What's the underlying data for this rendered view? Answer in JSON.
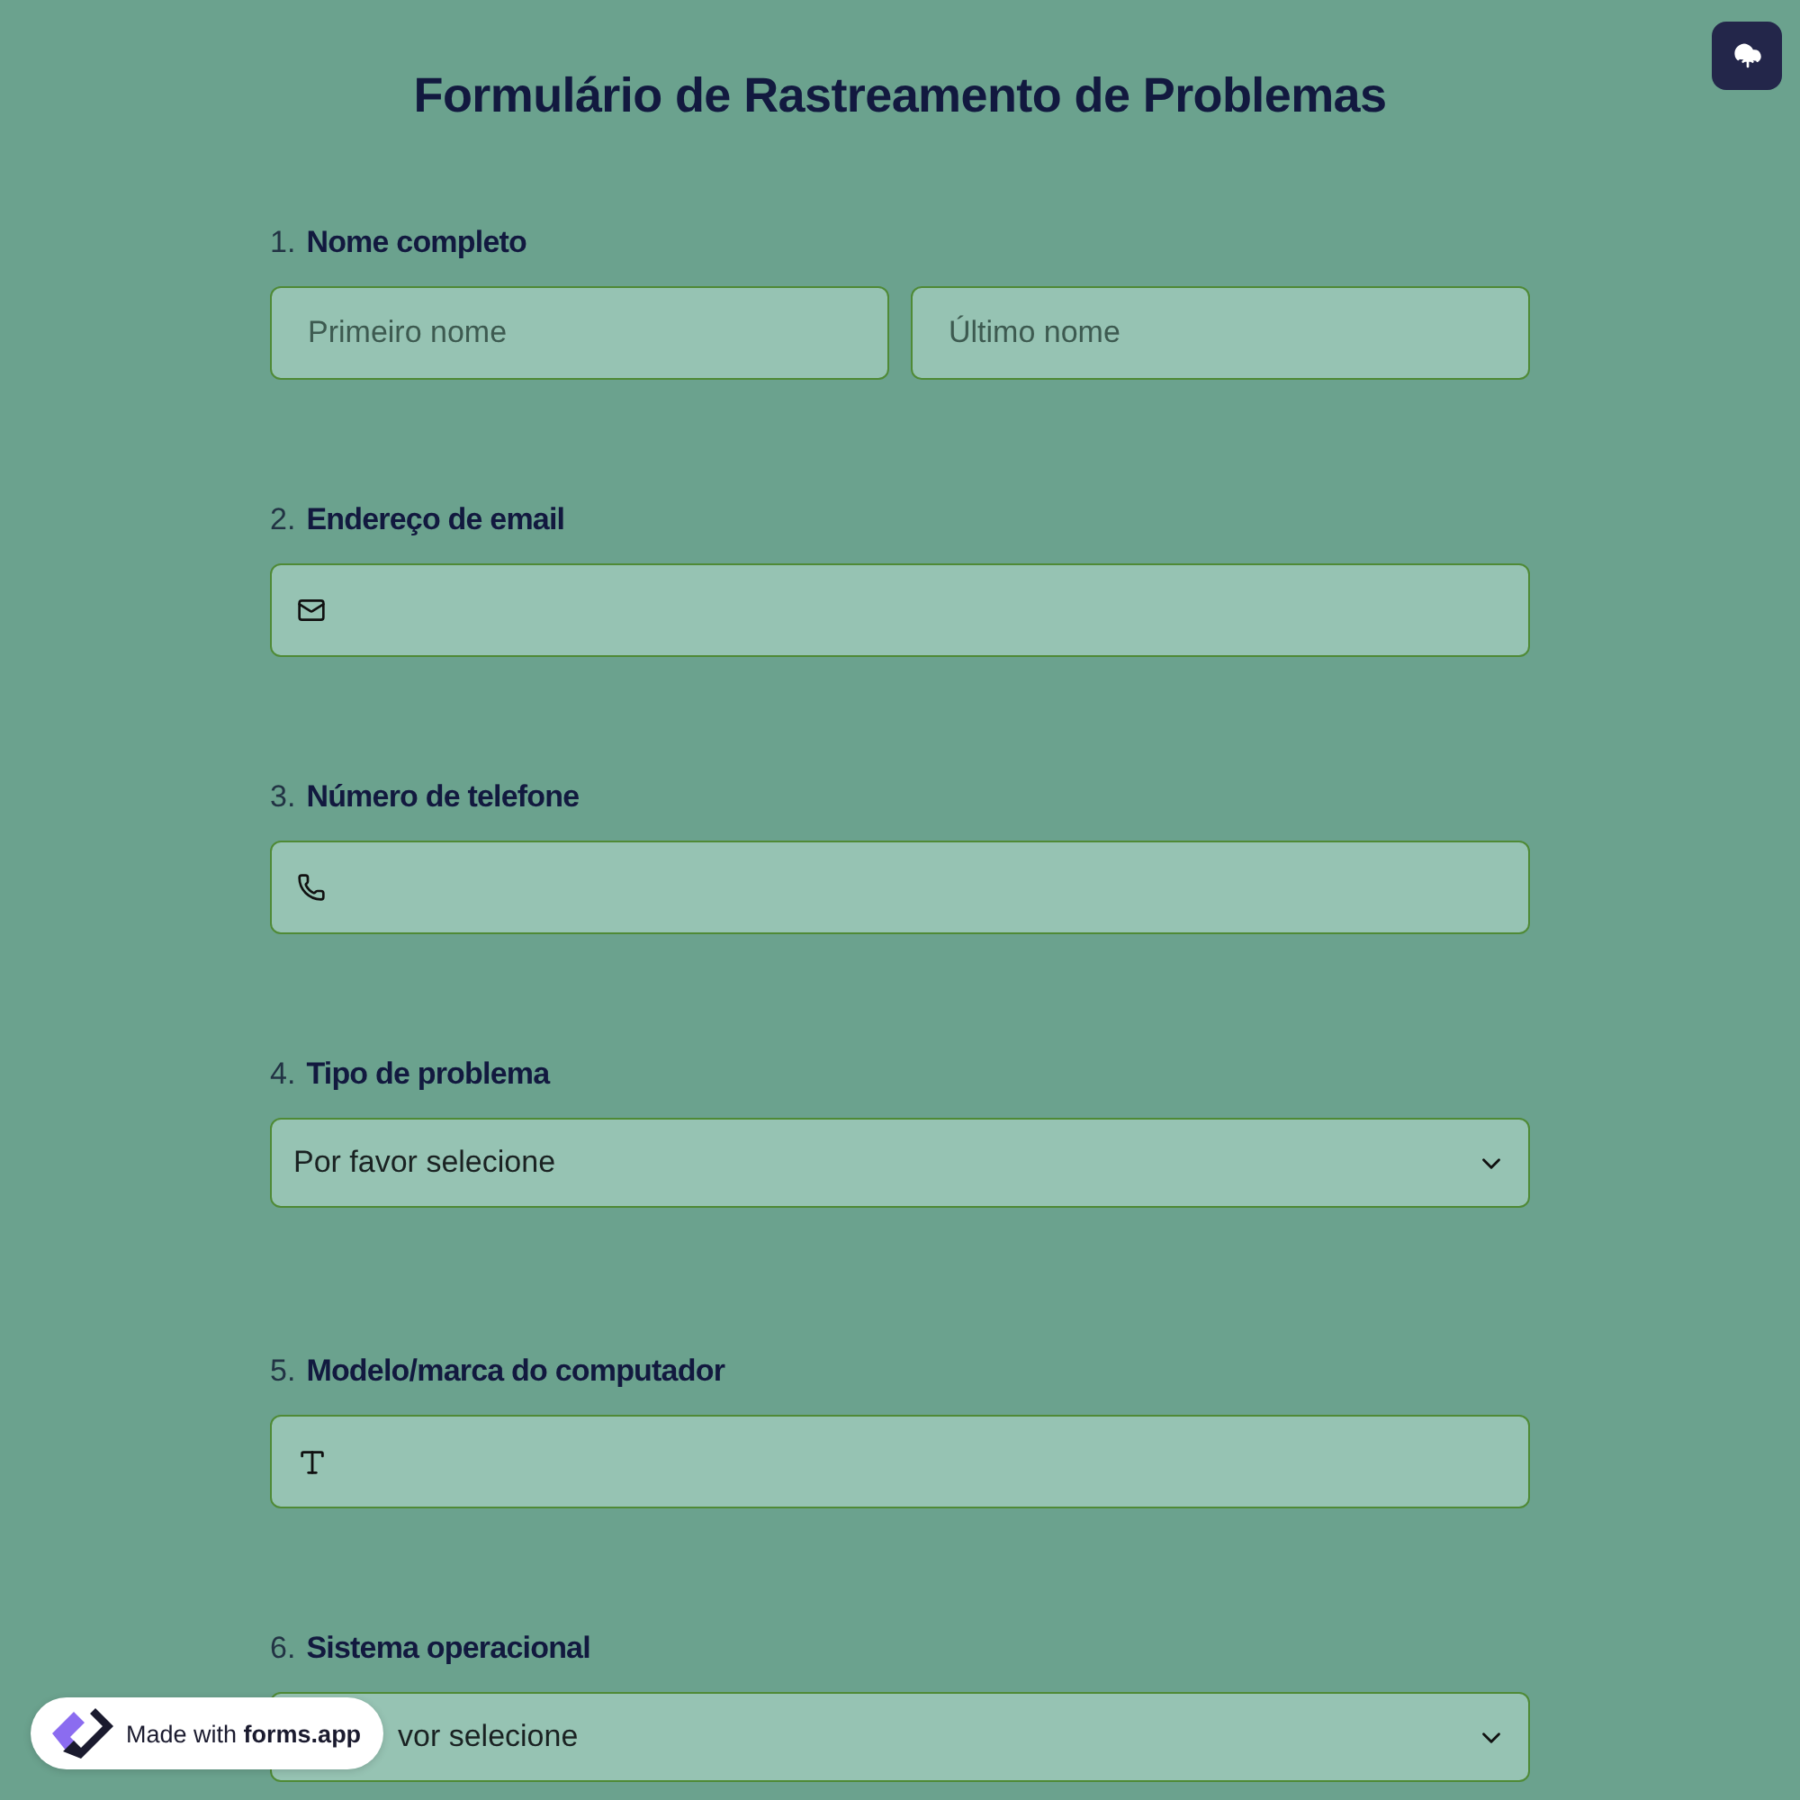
{
  "title": "Formulário de Rastreamento de Problemas",
  "questions": [
    {
      "number": "1.",
      "label": "Nome completo",
      "kind": "name",
      "placeholders": [
        "Primeiro nome",
        "Último nome"
      ]
    },
    {
      "number": "2.",
      "label": "Endereço de email",
      "kind": "email"
    },
    {
      "number": "3.",
      "label": "Número de telefone",
      "kind": "phone"
    },
    {
      "number": "4.",
      "label": "Tipo de problema",
      "kind": "select",
      "value": "Por favor selecione"
    },
    {
      "number": "5.",
      "label": "Modelo/marca do computador",
      "kind": "text"
    },
    {
      "number": "6.",
      "label": "Sistema operacional",
      "kind": "select",
      "value": "vor selecione",
      "covered": true
    }
  ],
  "badge": {
    "prefix": "Made with",
    "brand": "forms.app"
  }
}
